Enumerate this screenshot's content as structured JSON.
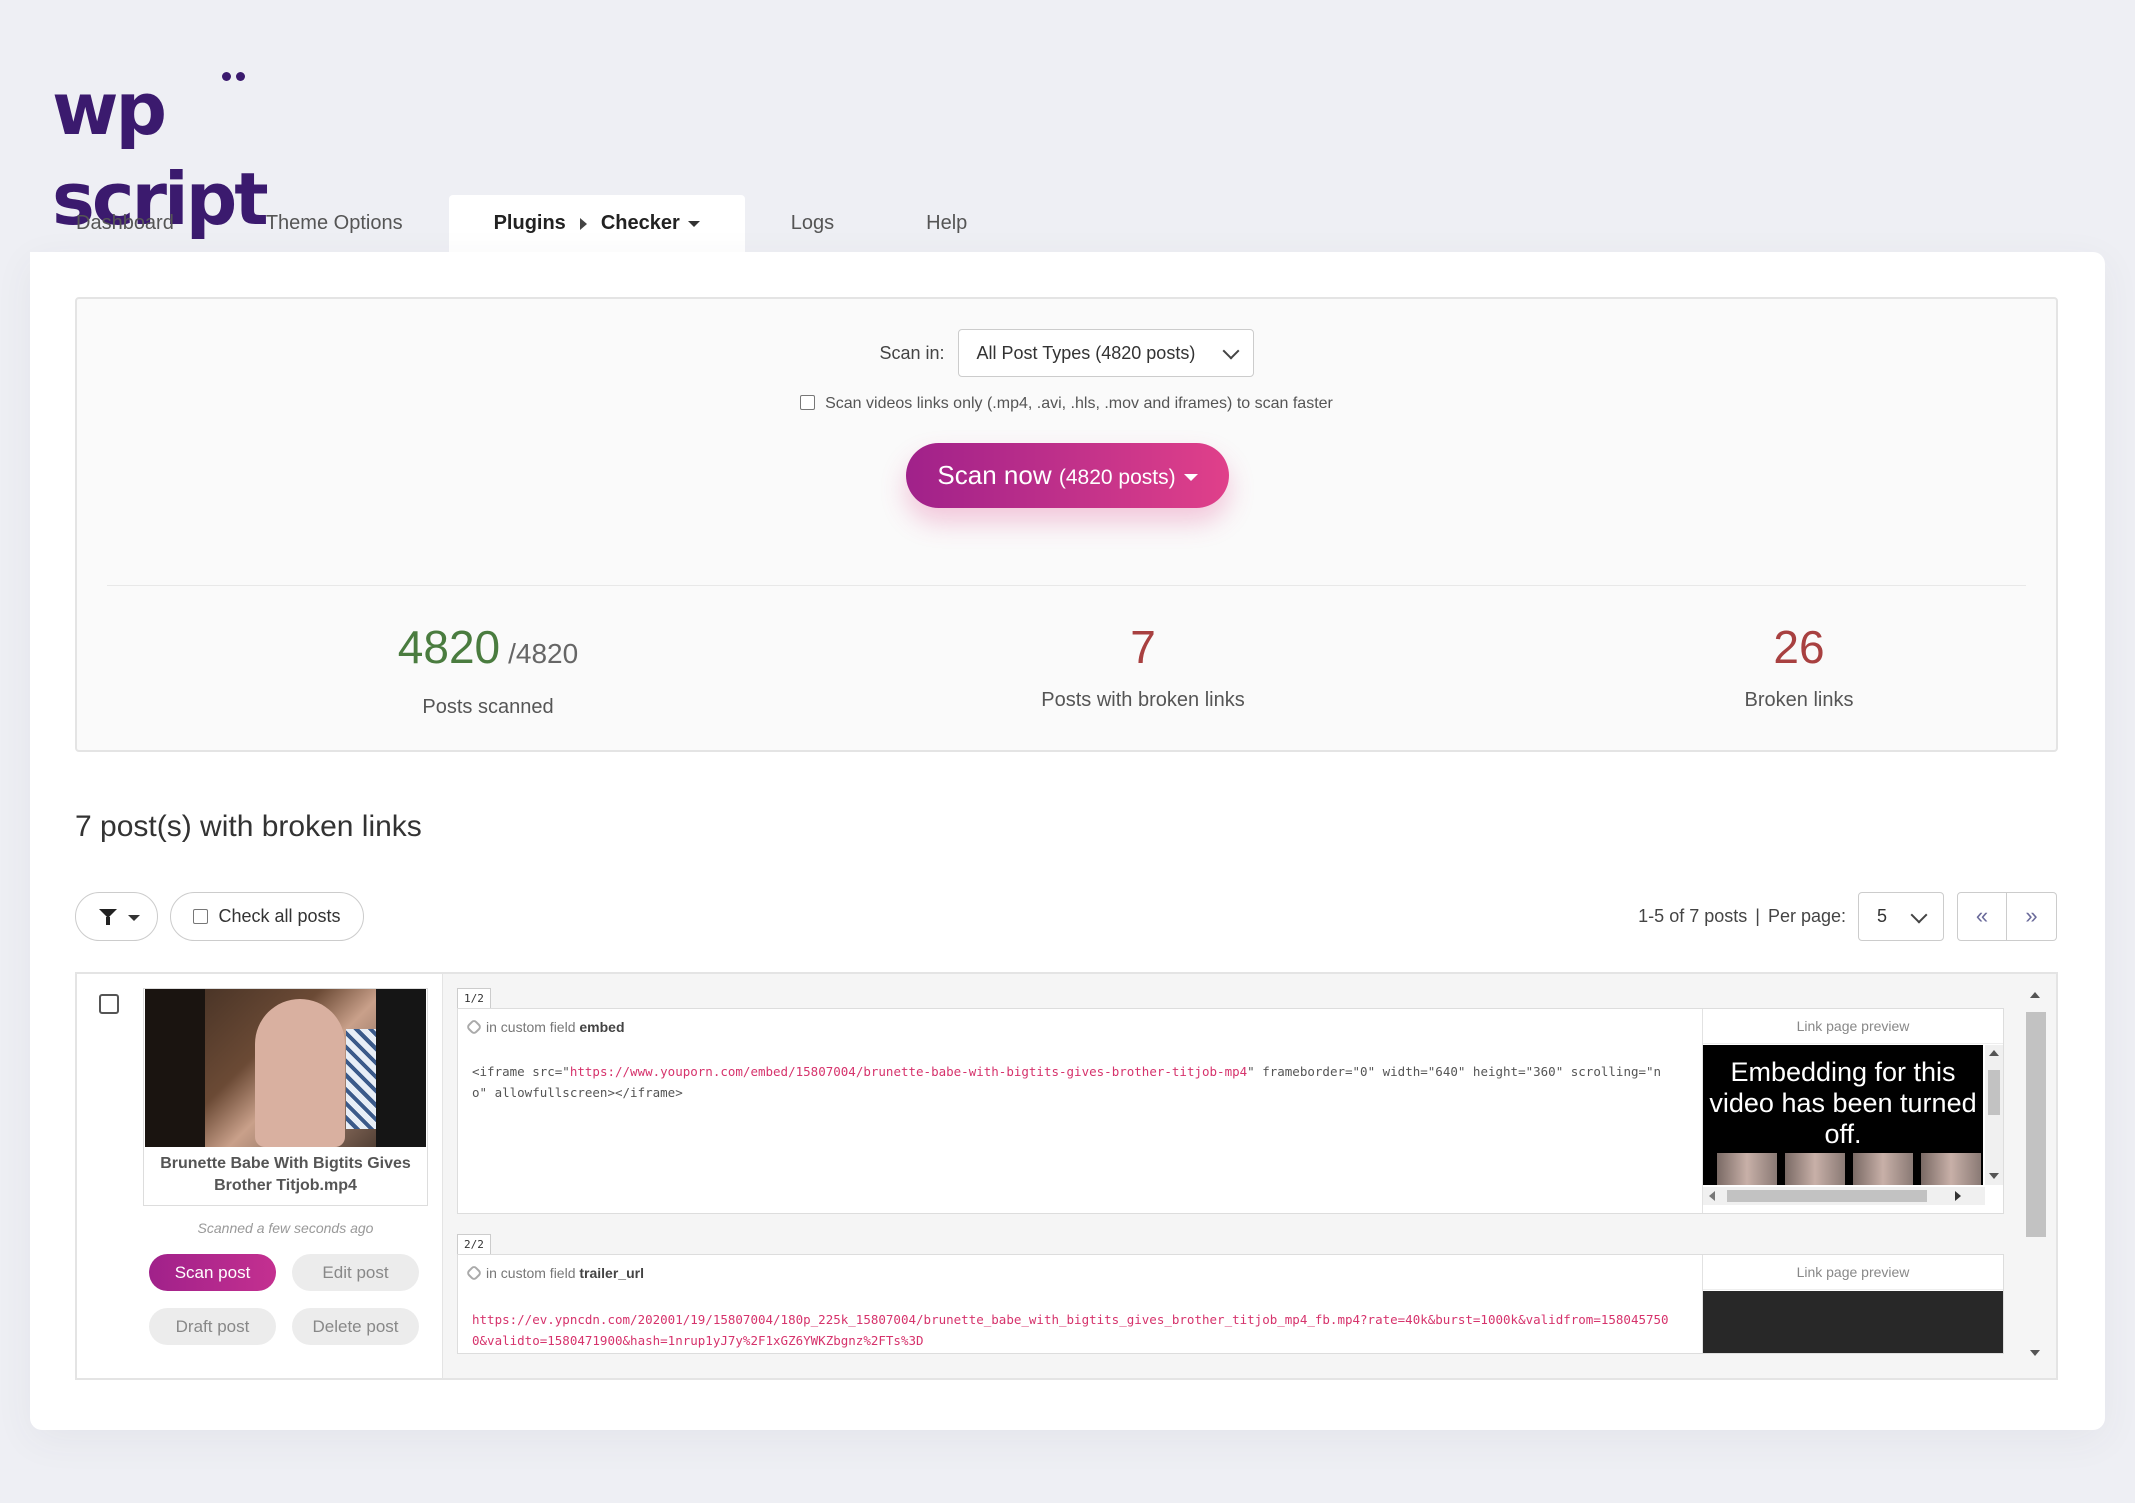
{
  "logo": {
    "text": "wp script"
  },
  "tabs": [
    {
      "label": "Dashboard"
    },
    {
      "label": "Theme Options"
    },
    {
      "label": "Plugins",
      "sub": "Checker"
    },
    {
      "label": "Logs"
    },
    {
      "label": "Help"
    }
  ],
  "scan": {
    "scan_in_label": "Scan in:",
    "scan_in_value": "All Post Types (4820 posts)",
    "videos_only_label": "Scan videos links only (.mp4, .avi, .hls, .mov and iframes) to scan faster",
    "button_label": "Scan now",
    "button_count": "(4820 posts)"
  },
  "stats": {
    "scanned": "4820",
    "total": "/4820",
    "scanned_label": "Posts scanned",
    "posts_broken": "7",
    "posts_broken_label": "Posts with broken links",
    "broken_links": "26",
    "broken_links_label": "Broken links"
  },
  "results": {
    "heading": "7 post(s) with broken links",
    "check_all_label": "Check all posts",
    "range": "1-5 of 7 posts",
    "sep": "|",
    "per_page_label": "Per page:",
    "per_page_value": "5",
    "prev": "«",
    "next": "»"
  },
  "post": {
    "title": "Brunette Babe With Bigtits Gives Brother Titjob.mp4",
    "scanned_time": "Scanned a few seconds ago",
    "actions": {
      "scan": "Scan post",
      "edit": "Edit post",
      "draft": "Draft post",
      "delete": "Delete post"
    },
    "links": [
      {
        "index": "1/2",
        "field_prefix": "in custom field",
        "field_name": "embed",
        "code_pre": "<iframe src=\"",
        "url": "https://www.youporn.com/embed/15807004/brunette-babe-with-bigtits-gives-brother-titjob-mp4",
        "code_post": "\" frameborder=\"0\" width=\"640\" height=\"360\" scrolling=\"no\" allowfullscreen></iframe>",
        "preview_label": "Link page preview",
        "preview_text": "Embedding for this video has been turned off."
      },
      {
        "index": "2/2",
        "field_prefix": "in custom field",
        "field_name": "trailer_url",
        "url": "https://ev.ypncdn.com/202001/19/15807004/180p_225k_15807004/brunette_babe_with_bigtits_gives_brother_titjob_mp4_fb.mp4?rate=40k&burst=1000k&validfrom=1580457500&validto=1580471900&hash=1nrup1yJ7y%2F1xGZ6YWKZbgnz%2FTs%3D",
        "preview_label": "Link page preview"
      }
    ]
  },
  "colors": {
    "accent_start": "#a0218a",
    "accent_end": "#e0408a",
    "scanned_green": "#4a7c3f",
    "broken_red": "#a84040",
    "logo_purple": "#3b1a6e"
  }
}
